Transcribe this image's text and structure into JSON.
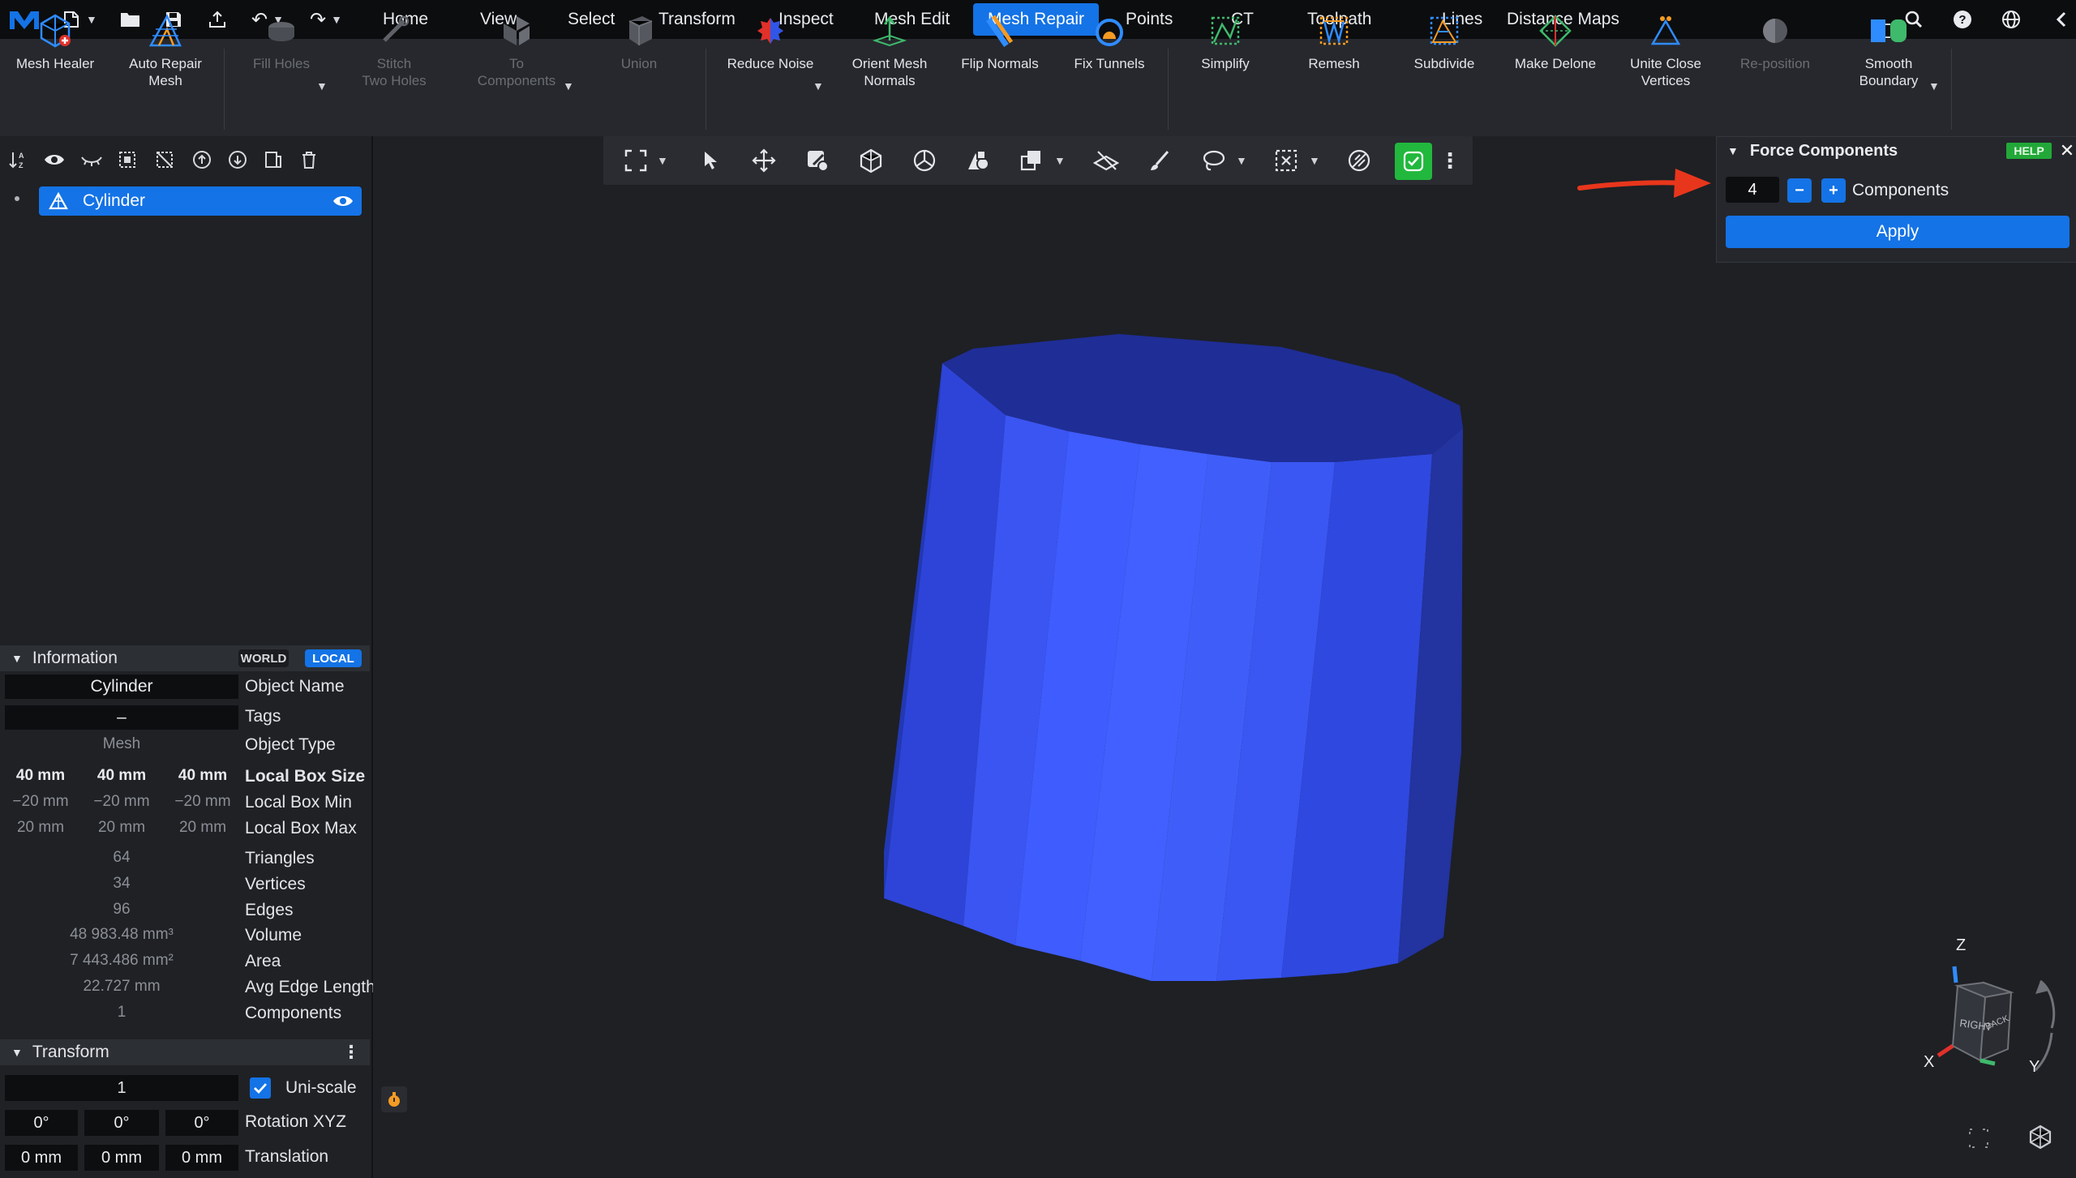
{
  "menubar": {
    "items": [
      "Home",
      "View",
      "Select",
      "Transform",
      "Inspect",
      "Mesh Edit",
      "Mesh Repair",
      "Points",
      "CT",
      "Toolpath",
      "Lines",
      "Distance Maps"
    ],
    "active": "Mesh Repair"
  },
  "ribbon": {
    "buttons": [
      {
        "label": "Mesh Healer"
      },
      {
        "label": "Auto Repair\nMesh"
      },
      {
        "label": "Fill Holes"
      },
      {
        "label": "Stitch\nTwo Holes"
      },
      {
        "label": "To\nComponents"
      },
      {
        "label": "Union"
      },
      {
        "label": "Reduce Noise"
      },
      {
        "label": "Orient Mesh\nNormals"
      },
      {
        "label": "Flip Normals"
      },
      {
        "label": "Fix Tunnels"
      },
      {
        "label": "Simplify"
      },
      {
        "label": "Remesh"
      },
      {
        "label": "Subdivide"
      },
      {
        "label": "Make Delone"
      },
      {
        "label": "Unite Close\nVertices"
      },
      {
        "label": "Re-position"
      },
      {
        "label": "Smooth\nBoundary"
      }
    ]
  },
  "scene_tree": {
    "object_name": "Cylinder"
  },
  "information": {
    "title": "Information",
    "world_label": "WORLD",
    "local_label": "LOCAL",
    "object_name_value": "Cylinder",
    "object_name_label": "Object Name",
    "tags_value": "–",
    "tags_label": "Tags",
    "object_type_value": "Mesh",
    "object_type_label": "Object Type",
    "box_size": [
      "40 mm",
      "40 mm",
      "40 mm"
    ],
    "box_size_label": "Local Box Size",
    "box_min": [
      "−20 mm",
      "−20 mm",
      "−20 mm"
    ],
    "box_min_label": "Local Box Min",
    "box_max": [
      "20 mm",
      "20 mm",
      "20 mm"
    ],
    "box_max_label": "Local Box Max",
    "triangles_value": "64",
    "triangles_label": "Triangles",
    "vertices_value": "34",
    "vertices_label": "Vertices",
    "edges_value": "96",
    "edges_label": "Edges",
    "volume_value": "48 983.48 mm³",
    "volume_label": "Volume",
    "area_value": "7 443.486 mm²",
    "area_label": "Area",
    "avg_edge_value": "22.727 mm",
    "avg_edge_label": "Avg Edge Length",
    "components_value": "1",
    "components_label": "Components"
  },
  "transform": {
    "title": "Transform",
    "scale_value": "1",
    "uniscale_label": "Uni-scale",
    "uniscale_checked": true,
    "rotation": [
      "0°",
      "0°",
      "0°"
    ],
    "rotation_label": "Rotation XYZ",
    "translation": [
      "0 mm",
      "0 mm",
      "0 mm"
    ],
    "translation_label": "Translation"
  },
  "force_components": {
    "title": "Force Components",
    "help_label": "HELP",
    "count_value": "4",
    "minus_label": "−",
    "plus_label": "+",
    "components_label": "Components",
    "apply_label": "Apply"
  },
  "view_cube": {
    "z_label": "Z",
    "x_label": "X",
    "y_label": "Y",
    "right_face": "RIGHT",
    "back_face": "BACK"
  },
  "colors": {
    "accent": "#1473e6",
    "help_green": "#22a838",
    "cylinder_side": "#3b57ff",
    "cylinder_top": "#1e2d9a",
    "arrow": "#e8361c"
  }
}
